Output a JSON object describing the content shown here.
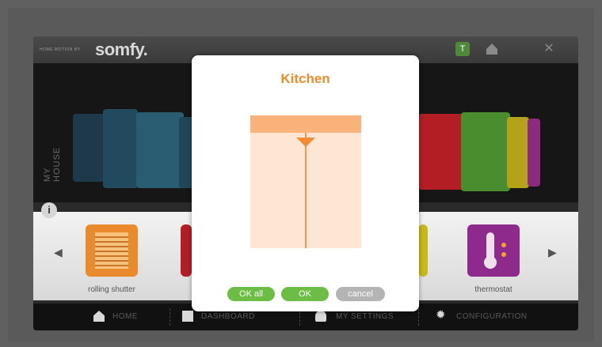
{
  "header": {
    "brand_tagline": "HOME MOTION BY",
    "brand_name": "somfy.",
    "icons": [
      "tree-icon",
      "home-icon",
      "close-icon"
    ]
  },
  "house_panel": {
    "label": "MY HOUSE"
  },
  "devices": [
    {
      "label": "rolling shutter",
      "icon": "rolling-shutter-icon",
      "color": "#e98a2c"
    },
    {
      "label": "thermostat",
      "icon": "thermostat-icon",
      "color": "#8e2a8c"
    }
  ],
  "nav": {
    "home": "HOME",
    "dashboard": "DASHBOARD",
    "my_settings": "MY SETTINGS",
    "configuration": "CONFIGURATION"
  },
  "modal": {
    "title": "Kitchen",
    "ok_all": "OK all",
    "ok": "OK",
    "cancel": "cancel",
    "accent_color": "#f28a2c",
    "ok_color": "#6bbd45"
  }
}
